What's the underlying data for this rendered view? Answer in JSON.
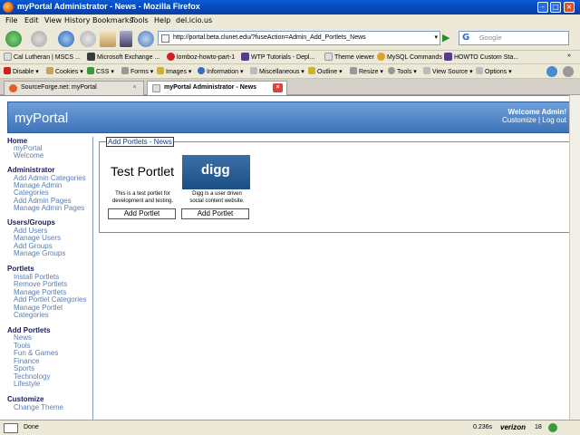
{
  "window": {
    "title": "myPortal Administrator - News - Mozilla Firefox"
  },
  "menu": [
    "File",
    "Edit",
    "View",
    "History",
    "Bookmarks",
    "Tools",
    "Help",
    "del.icio.us"
  ],
  "address": {
    "url": "http://portal.beta.clunet.edu/?fuseAction=Admin_Add_Portlets_News"
  },
  "search": {
    "placeholder": "Google",
    "engine": "G"
  },
  "bookmarks": [
    "Cal Lutheran | MSCS ...",
    "Microsoft Exchange ...",
    "lomboz-howto-part-1",
    "WTP Tutorials - Depl...",
    "Theme viewer",
    "MySQL Commands",
    "HOWTO Custom Sta..."
  ],
  "devtoolbar": [
    "Disable",
    "Cookies",
    "CSS",
    "Forms",
    "Images",
    "Information",
    "Miscellaneous",
    "Outline",
    "Resize",
    "Tools",
    "View Source",
    "Options"
  ],
  "tabs": [
    {
      "label": "SourceForge.net: myPortal"
    },
    {
      "label": "myPortal Administrator - News"
    }
  ],
  "header": {
    "brand": "myPortal",
    "welcome": "Welcome Admin!",
    "customize": "Customize",
    "separator": "|",
    "logout": "Log out"
  },
  "sidebar": {
    "home": {
      "title": "Home",
      "items": [
        "myPortal",
        "Welcome"
      ]
    },
    "administrator": {
      "title": "Administrator",
      "items": [
        "Add Admin Categories",
        "Manage Admin",
        "Categories",
        "Add Admin Pages",
        "Manage Admin Pages"
      ]
    },
    "users": {
      "title": "Users/Groups",
      "items": [
        "Add Users",
        "Manage Users",
        "Add Groups",
        "Manage Groups"
      ]
    },
    "portlets": {
      "title": "Portlets",
      "items": [
        "Install Portlets",
        "Remove Portlets",
        "Manage Portlets",
        "Add Portlet Categories",
        "Manage Portlet",
        "Categories"
      ]
    },
    "add_portlets": {
      "title": "Add Portlets",
      "items": [
        "News",
        "Tools",
        "Fun & Games",
        "Finance",
        "Sports",
        "Technology",
        "Lifestyle"
      ]
    },
    "customize": {
      "title": "Customize",
      "items": [
        "Change Theme"
      ]
    }
  },
  "panel": {
    "legend": "Add Portlets - News",
    "portlets": [
      {
        "title": "Test Portlet",
        "desc1": "This is a test portlet for",
        "desc2": "development and testing.",
        "button": "Add Portlet"
      },
      {
        "logo": "digg",
        "desc1": "Digg is a user driven",
        "desc2": "social content website.",
        "button": "Add Portlet"
      }
    ]
  },
  "status": {
    "text": "Done",
    "time": "0.236s",
    "carrier": "verizon",
    "count": "18"
  },
  "colors": {
    "header": "#3f74b9",
    "link": "#5a7fb0",
    "section": "#1a1a5e",
    "titlebar": "#0646b8"
  }
}
